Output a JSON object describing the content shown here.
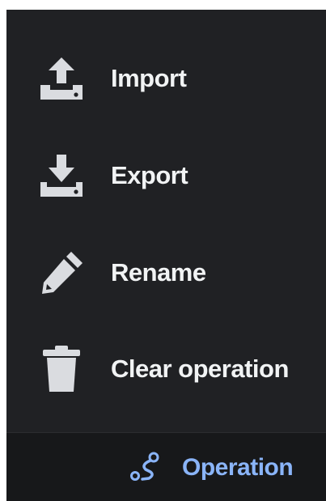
{
  "menu": {
    "items": [
      {
        "label": "Import",
        "icon": "upload-tray-icon"
      },
      {
        "label": "Export",
        "icon": "download-tray-icon"
      },
      {
        "label": "Rename",
        "icon": "pencil-icon"
      },
      {
        "label": "Clear operation",
        "icon": "trash-icon"
      }
    ]
  },
  "footer": {
    "label": "Operation",
    "icon": "route-icon"
  },
  "colors": {
    "panel_bg": "#202124",
    "footer_bg": "#17181a",
    "text": "#f1f3f4",
    "icon": "#dadce0",
    "accent": "#8ab4f8"
  }
}
